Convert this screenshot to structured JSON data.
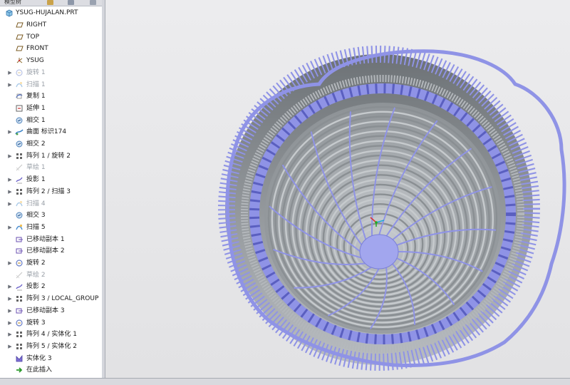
{
  "toolbar": {
    "tab_label": "模型树"
  },
  "tree": {
    "root": {
      "label": "YSUG-HUJALAN.PRT",
      "icon": "part-icon"
    },
    "items": [
      {
        "label": "RIGHT",
        "icon": "datum-plane-icon",
        "expander": "",
        "suppressed": false
      },
      {
        "label": "TOP",
        "icon": "datum-plane-icon",
        "expander": "",
        "suppressed": false
      },
      {
        "label": "FRONT",
        "icon": "datum-plane-icon",
        "expander": "",
        "suppressed": false
      },
      {
        "label": "YSUG",
        "icon": "coordinate-system-icon",
        "expander": "",
        "suppressed": false
      },
      {
        "label": "旋转 1",
        "icon": "revolve-icon",
        "expander": "▶",
        "suppressed": true
      },
      {
        "label": "扫描 1",
        "icon": "sweep-icon",
        "expander": "▶",
        "suppressed": true
      },
      {
        "label": "复制 1",
        "icon": "copy-icon",
        "expander": "",
        "suppressed": false
      },
      {
        "label": "延伸 1",
        "icon": "extend-icon",
        "expander": "",
        "suppressed": false
      },
      {
        "label": "相交 1",
        "icon": "intersect-icon",
        "expander": "",
        "suppressed": false
      },
      {
        "label": "曲面 标识174",
        "icon": "surface-icon",
        "expander": "▶",
        "suppressed": false
      },
      {
        "label": "相交 2",
        "icon": "intersect-icon",
        "expander": "",
        "suppressed": false
      },
      {
        "label": "阵列 1 / 旋转 2",
        "icon": "pattern-icon",
        "expander": "▶",
        "suppressed": false
      },
      {
        "label": "草绘 1",
        "icon": "sketch-icon",
        "expander": "",
        "suppressed": true
      },
      {
        "label": "投影 1",
        "icon": "projection-icon",
        "expander": "▶",
        "suppressed": false
      },
      {
        "label": "阵列 2 / 扫描 3",
        "icon": "pattern-icon",
        "expander": "▶",
        "suppressed": false
      },
      {
        "label": "扫描 4",
        "icon": "sweep-icon",
        "expander": "▶",
        "suppressed": true
      },
      {
        "label": "相交 3",
        "icon": "intersect-icon",
        "expander": "",
        "suppressed": false
      },
      {
        "label": "扫描 5",
        "icon": "sweep-icon",
        "expander": "▶",
        "suppressed": false
      },
      {
        "label": "已移动副本 1",
        "icon": "moved-copy-icon",
        "expander": "",
        "suppressed": false
      },
      {
        "label": "已移动副本 2",
        "icon": "moved-copy-icon",
        "expander": "",
        "suppressed": false
      },
      {
        "label": "旋转 2",
        "icon": "revolve-icon",
        "expander": "▶",
        "suppressed": false
      },
      {
        "label": "草绘 2",
        "icon": "sketch-icon",
        "expander": "",
        "suppressed": true
      },
      {
        "label": "投影 2",
        "icon": "projection-icon",
        "expander": "▶",
        "suppressed": false
      },
      {
        "label": "阵列 3 / LOCAL_GROUP",
        "icon": "pattern-icon",
        "expander": "▶",
        "suppressed": false
      },
      {
        "label": "已移动副本 3",
        "icon": "moved-copy-icon",
        "expander": "▶",
        "suppressed": false
      },
      {
        "label": "旋转 3",
        "icon": "revolve-icon",
        "expander": "▶",
        "suppressed": false
      },
      {
        "label": "阵列 4 / 实体化 1",
        "icon": "pattern-icon",
        "expander": "▶",
        "suppressed": false
      },
      {
        "label": "阵列 5 / 实体化 2",
        "icon": "pattern-icon",
        "expander": "▶",
        "suppressed": false
      },
      {
        "label": "实体化 3",
        "icon": "solidify-icon",
        "expander": "",
        "suppressed": false
      },
      {
        "label": "在此插入",
        "icon": "insert-here-arrow-icon",
        "expander": "",
        "suppressed": false
      }
    ]
  },
  "colors": {
    "model_blue": "#8f93e6",
    "model_grey": "#a4a9ad",
    "background": "#e8e8ea",
    "suppressed_text": "#9aa0a8"
  }
}
